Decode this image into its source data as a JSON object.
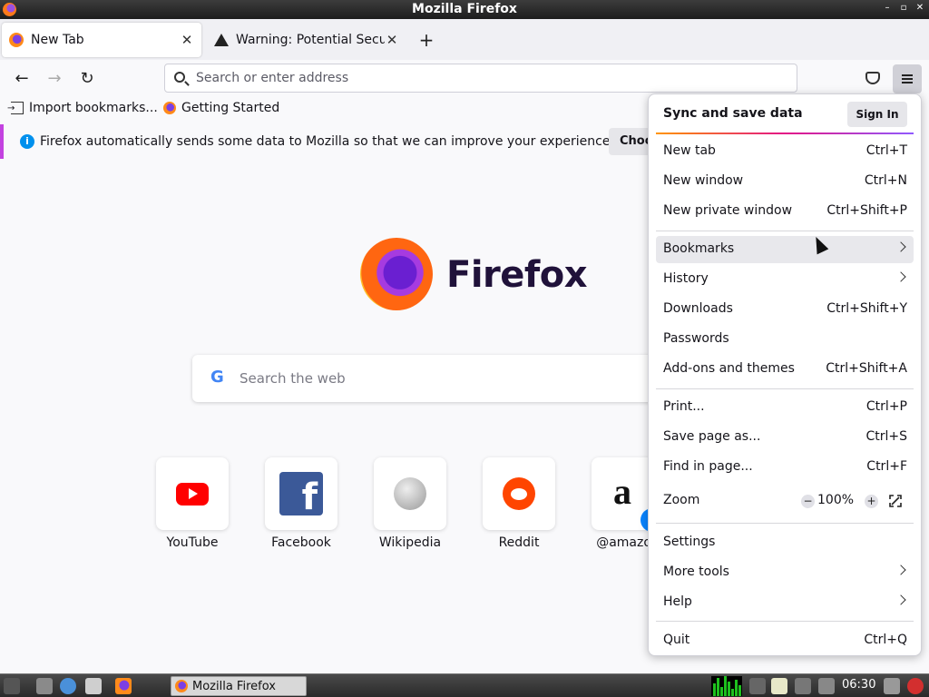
{
  "window": {
    "title": "Mozilla Firefox",
    "controls": [
      "–",
      "▫",
      "✕"
    ]
  },
  "tabs": [
    {
      "label": "New Tab",
      "icon": "firefox-icon",
      "active": true
    },
    {
      "label": "Warning: Potential Securi",
      "icon": "warning-icon",
      "active": false
    }
  ],
  "newtab_glyph": "+",
  "nav": {
    "back": "←",
    "forward": "→",
    "reload": "↻",
    "address_placeholder": "Search or enter address"
  },
  "bookmarks": [
    {
      "label": "Import bookmarks...",
      "icon": "import-icon"
    },
    {
      "label": "Getting Started",
      "icon": "firefox-icon"
    }
  ],
  "notification": {
    "message": "Firefox automatically sends some data to Mozilla so that we can improve your experience.",
    "button": "Choose"
  },
  "newtab_page": {
    "wordmark": "Firefox",
    "search_placeholder": "Search the web",
    "search_engine_glyph": "G",
    "top_sites": [
      {
        "label": "YouTube",
        "icon": "youtube-icon"
      },
      {
        "label": "Facebook",
        "icon": "facebook-icon"
      },
      {
        "label": "Wikipedia",
        "icon": "wikipedia-icon"
      },
      {
        "label": "Reddit",
        "icon": "reddit-icon"
      },
      {
        "label": "@amazon",
        "icon": "amazon-icon"
      }
    ],
    "facebook_glyph": "f",
    "amazon_glyph": "a"
  },
  "menu": {
    "header": "Sync and save data",
    "sign_in": "Sign In",
    "items": [
      {
        "label": "New tab",
        "shortcut": "Ctrl+T"
      },
      {
        "label": "New window",
        "shortcut": "Ctrl+N"
      },
      {
        "label": "New private window",
        "shortcut": "Ctrl+Shift+P"
      },
      {
        "label": "Bookmarks",
        "submenu": true
      },
      {
        "label": "History",
        "submenu": true
      },
      {
        "label": "Downloads",
        "shortcut": "Ctrl+Shift+Y"
      },
      {
        "label": "Passwords",
        "shortcut": ""
      },
      {
        "label": "Add-ons and themes",
        "shortcut": "Ctrl+Shift+A"
      },
      {
        "label": "Print...",
        "shortcut": "Ctrl+P"
      },
      {
        "label": "Save page as...",
        "shortcut": "Ctrl+S"
      },
      {
        "label": "Find in page...",
        "shortcut": "Ctrl+F"
      },
      {
        "label": "Zoom",
        "zoom_out": "−",
        "zoom_value": "100%",
        "zoom_in": "+"
      },
      {
        "label": "Settings",
        "submenu": false
      },
      {
        "label": "More tools",
        "submenu": true
      },
      {
        "label": "Help",
        "submenu": true
      },
      {
        "label": "Quit",
        "shortcut": "Ctrl+Q"
      }
    ]
  },
  "taskbar": {
    "task_label": "Mozilla Firefox",
    "clock": "06:30"
  },
  "colors": {
    "accent": "#0090ed",
    "menu_hover": "#e8e8ec",
    "sync_gradient": [
      "#ff9500",
      "#e31587",
      "#9059ff"
    ]
  }
}
